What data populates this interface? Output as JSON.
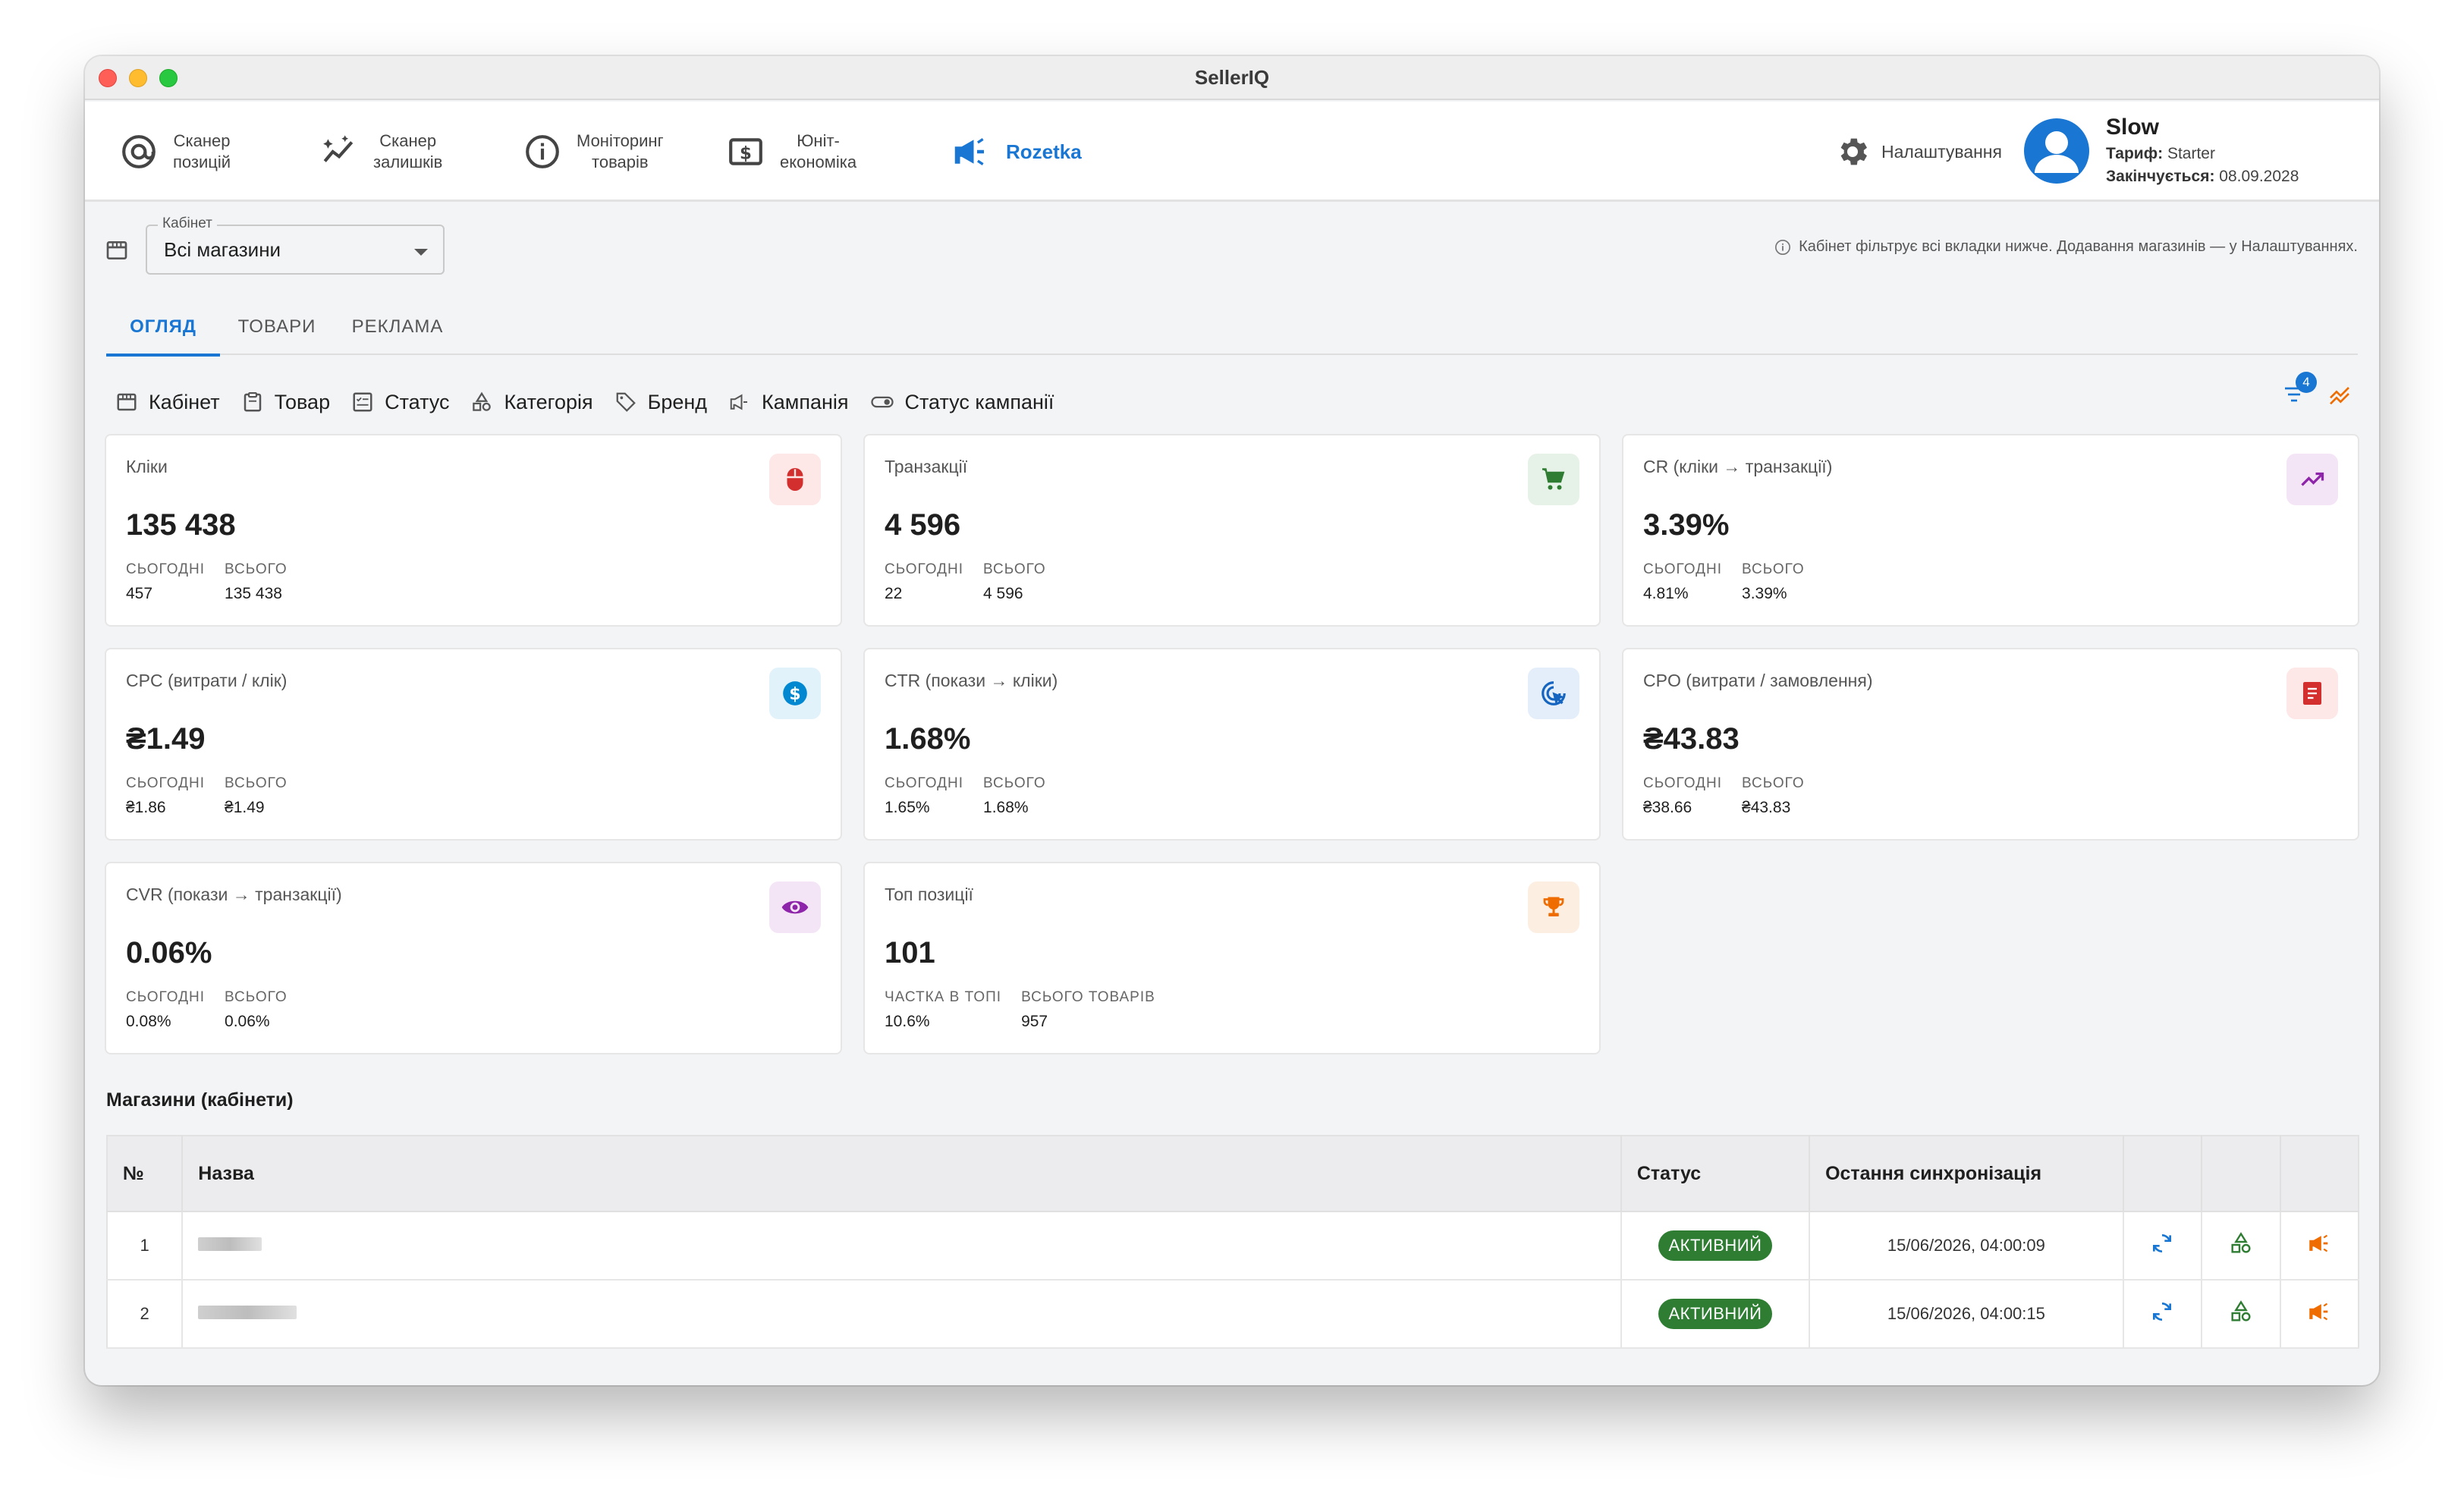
{
  "window": {
    "title": "SellerIQ"
  },
  "nav": {
    "position_scanner": "Сканер\nпозицій",
    "stock_scanner": "Сканер\nзалишків",
    "monitoring": "Моніторинг\nтоварів",
    "unit_economics": "Юніт-\nекономіка",
    "rozetka": "Rozetka",
    "settings": "Налаштування"
  },
  "user": {
    "name": "Slow",
    "plan_label": "Тариф:",
    "plan": "Starter",
    "expires_label": "Закінчується:",
    "expires": "08.09.2028"
  },
  "cabinet": {
    "label": "Кабінет",
    "value": "Всі магазини",
    "hint": "Кабінет фільтрує всі вкладки нижче. Додавання магазинів — у Налаштуваннях."
  },
  "tabs": [
    "ОГЛЯД",
    "ТОВАРИ",
    "РЕКЛАМА"
  ],
  "filters": [
    "Кабінет",
    "Товар",
    "Статус",
    "Категорія",
    "Бренд",
    "Кампанія",
    "Статус кампанії"
  ],
  "filter_badge": "4",
  "cards": [
    {
      "title": "Кліки",
      "value": "135 438",
      "sub1_label": "СЬОГОДНІ",
      "sub1": "457",
      "sub2_label": "ВСЬОГО",
      "sub2": "135 438",
      "icon": "mouse-icon",
      "icon_color": "#d32f2f",
      "icon_bg": "#fde7e7"
    },
    {
      "title": "Транзакції",
      "value": "4 596",
      "sub1_label": "СЬОГОДНІ",
      "sub1": "22",
      "sub2_label": "ВСЬОГО",
      "sub2": "4 596",
      "icon": "cart-icon",
      "icon_color": "#2e7d32",
      "icon_bg": "#e6f2e7"
    },
    {
      "title": "CR (кліки → транзакції)",
      "value": "3.39%",
      "sub1_label": "СЬОГОДНІ",
      "sub1": "4.81%",
      "sub2_label": "ВСЬОГО",
      "sub2": "3.39%",
      "icon": "trending-up-icon",
      "icon_color": "#8e24aa",
      "icon_bg": "#f3e5f5"
    },
    {
      "title": "CPC (витрати / клік)",
      "value": "₴1.49",
      "sub1_label": "СЬОГОДНІ",
      "sub1": "₴1.86",
      "sub2_label": "ВСЬОГО",
      "sub2": "₴1.49",
      "icon": "dollar-icon",
      "icon_color": "#0288d1",
      "icon_bg": "#e1f2fb"
    },
    {
      "title": "CTR (покази → кліки)",
      "value": "1.68%",
      "sub1_label": "СЬОГОДНІ",
      "sub1": "1.65%",
      "sub2_label": "ВСЬОГО",
      "sub2": "1.68%",
      "icon": "ads-click-icon",
      "icon_color": "#1565c0",
      "icon_bg": "#e3eefa"
    },
    {
      "title": "CPO (витрати / замовлення)",
      "value": "₴43.83",
      "sub1_label": "СЬОГОДНІ",
      "sub1": "₴38.66",
      "sub2_label": "ВСЬОГО",
      "sub2": "₴43.83",
      "icon": "receipt-icon",
      "icon_color": "#d32f2f",
      "icon_bg": "#fde7e7"
    },
    {
      "title": "CVR (покази → транзакції)",
      "value": "0.06%",
      "sub1_label": "СЬОГОДНІ",
      "sub1": "0.08%",
      "sub2_label": "ВСЬОГО",
      "sub2": "0.06%",
      "icon": "eye-icon",
      "icon_color": "#8e24aa",
      "icon_bg": "#f3e5f5"
    },
    {
      "title": "Топ позиції",
      "value": "101",
      "sub1_label": "ЧАСТКА В ТОПІ",
      "sub1": "10.6%",
      "sub2_label": "ВСЬОГО ТОВАРІВ",
      "sub2": "957",
      "icon": "trophy-icon",
      "icon_color": "#ef6c00",
      "icon_bg": "#fdeee2"
    }
  ],
  "stores": {
    "title": "Магазини (кабінети)",
    "columns": [
      "№",
      "Назва",
      "Статус",
      "Остання синхронізація"
    ],
    "rows": [
      {
        "num": "1",
        "status": "АКТИВНИЙ",
        "sync": "15/06/2026, 04:00:09"
      },
      {
        "num": "2",
        "status": "АКТИВНИЙ",
        "sync": "15/06/2026, 04:00:15"
      }
    ]
  },
  "colors": {
    "accent": "#1976d2",
    "status_green": "#2e7d32",
    "orange": "#ef6c00"
  }
}
